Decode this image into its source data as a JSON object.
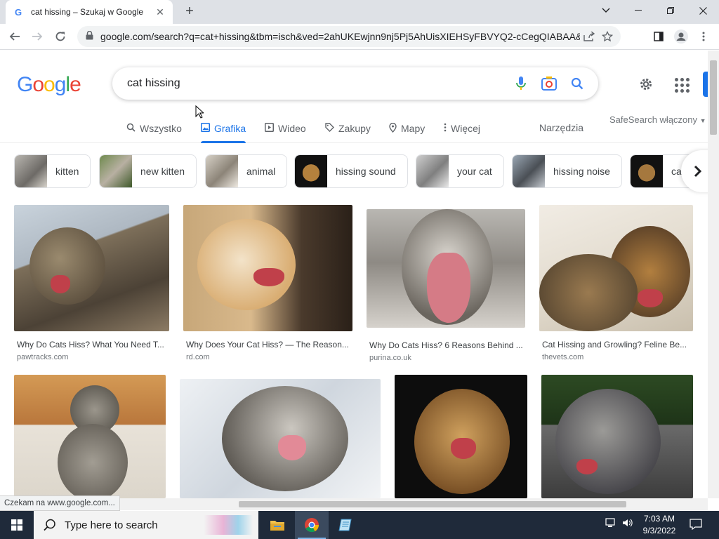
{
  "browser": {
    "tab_title": "cat hissing – Szukaj w Google",
    "url": "google.com/search?q=cat+hissing&tbm=isch&ved=2ahUKEwjnn9nj5Pj5AhUisXIEHSyFBVYQ2-cCegQIABAA&oq...",
    "status_text": "Czekam na www.google.com..."
  },
  "google": {
    "logo_letters": [
      "G",
      "o",
      "o",
      "g",
      "l",
      "e"
    ],
    "logo_colors": [
      "#4285f4",
      "#ea4335",
      "#fbbc05",
      "#4285f4",
      "#34a853",
      "#ea4335"
    ],
    "query": "cat hissing",
    "tabs": [
      {
        "label": "Wszystko",
        "icon": "search-icon",
        "active": false
      },
      {
        "label": "Grafika",
        "icon": "image-icon",
        "active": true
      },
      {
        "label": "Wideo",
        "icon": "video-icon",
        "active": false
      },
      {
        "label": "Zakupy",
        "icon": "tag-icon",
        "active": false
      },
      {
        "label": "Mapy",
        "icon": "map-pin-icon",
        "active": false
      },
      {
        "label": "Więcej",
        "icon": "more-vert-icon",
        "active": false
      }
    ],
    "tools_label": "Narzędzia",
    "safesearch_label": "SafeSearch włączony",
    "chips": [
      "kitten",
      "new kitten",
      "animal",
      "hissing sound",
      "your cat",
      "hissing noise",
      "ca"
    ],
    "results": [
      {
        "title": "Why Do Cats Hiss? What You Need T...",
        "source": "pawtracks.com"
      },
      {
        "title": "Why Does Your Cat Hiss? — The Reason...",
        "source": "rd.com"
      },
      {
        "title": "Why Do Cats Hiss? 6 Reasons Behind ...",
        "source": "purina.co.uk"
      },
      {
        "title": "Cat Hissing and Growling? Feline Be...",
        "source": "thevets.com"
      },
      {
        "title": "",
        "source": ""
      },
      {
        "title": "",
        "source": ""
      },
      {
        "title": "",
        "source": ""
      },
      {
        "title": "",
        "source": ""
      }
    ],
    "accent_color": "#1a73e8"
  },
  "taskbar": {
    "search_placeholder": "Type here to search",
    "time": "7:03 AM",
    "date": "9/3/2022"
  }
}
